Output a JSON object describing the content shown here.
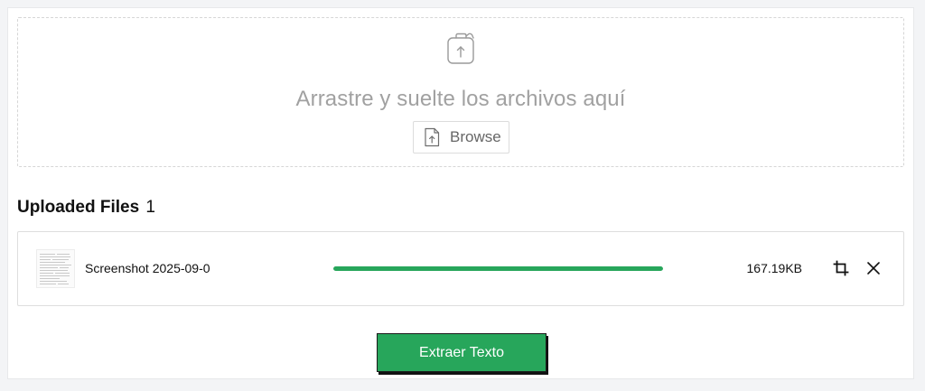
{
  "dropzone": {
    "instruction": "Arrastre y suelte los archivos aquí",
    "browse_label": "Browse",
    "icon": "upload-file-icon"
  },
  "uploaded": {
    "title": "Uploaded Files",
    "count": "1",
    "files": [
      {
        "name": "Screenshot 2025-09-0",
        "size": "167.19KB",
        "progress_percent": 100
      }
    ]
  },
  "actions": {
    "extract_label": "Extraer Texto"
  },
  "colors": {
    "accent": "#27a65b",
    "placeholder_text": "#a1a1a1",
    "border": "#dedede"
  }
}
